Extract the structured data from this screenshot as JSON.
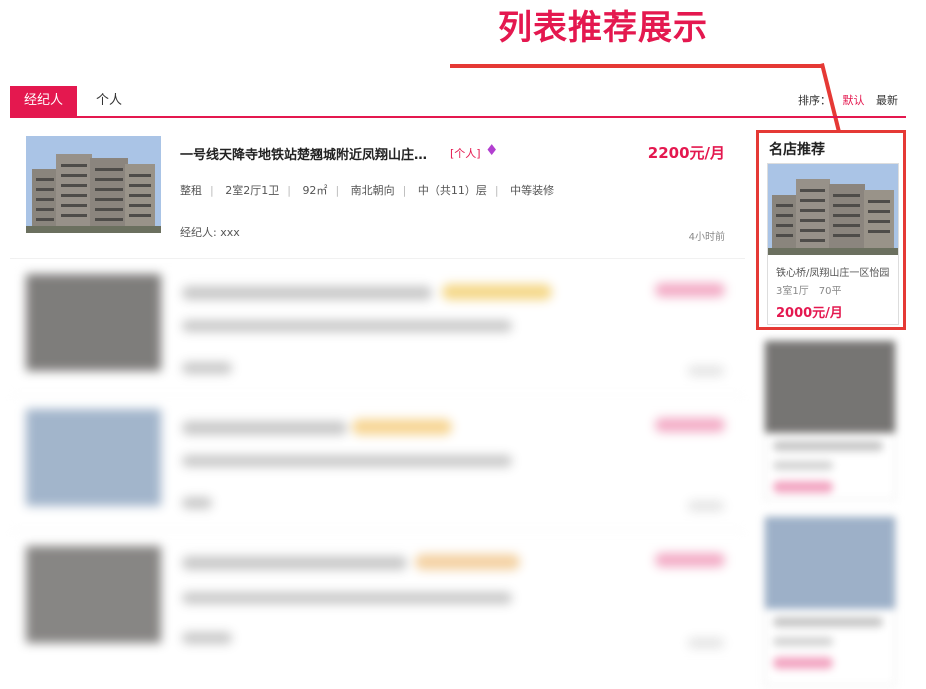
{
  "annotation": {
    "title": "列表推荐展示"
  },
  "tabs": [
    {
      "label": "经纪人",
      "active": true
    },
    {
      "label": "个人",
      "active": false
    }
  ],
  "sort": {
    "label": "排序：",
    "options": [
      {
        "label": "默认",
        "active": true
      },
      {
        "label": "最新",
        "active": false
      }
    ]
  },
  "listing": {
    "title": "一号线天降寺地铁站楚翘城附近凤翔山庄精装...",
    "tag": "[个人]",
    "badge_icon": "diamond-icon",
    "price": "2200元/月",
    "meta": [
      "整租",
      "2室2厅1卫",
      "92㎡",
      "南北朝向",
      "中（共11）层",
      "中等装修"
    ],
    "agent": "经纪人: xxx",
    "time": "4小时前"
  },
  "sidebar": {
    "title": "名店推荐",
    "card": {
      "name": "铁心桥/凤翔山庄一区怡园",
      "rooms": "3室1厅",
      "area": "70平",
      "price": "2000元/月"
    }
  },
  "colors": {
    "accent": "#e4184f",
    "annotation": "#e53935"
  }
}
